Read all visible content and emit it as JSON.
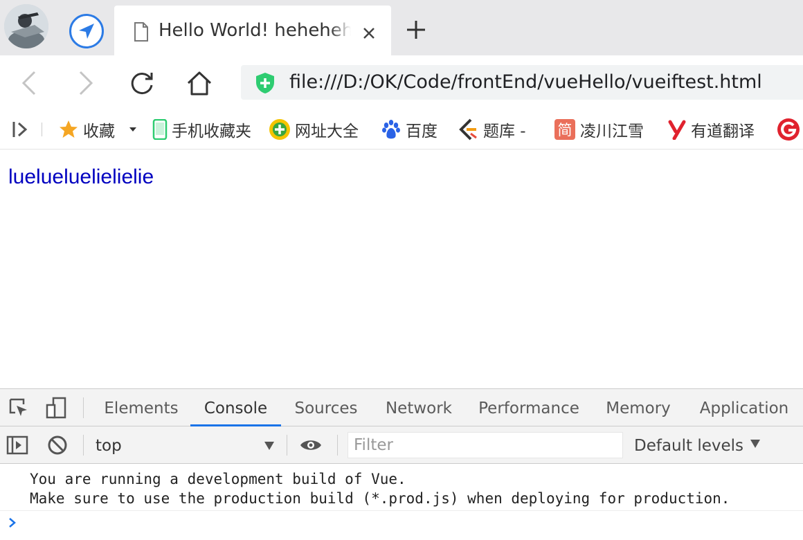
{
  "tab": {
    "title": "Hello World! hehehehehe"
  },
  "toolbar": {
    "url": "file:///D:/OK/Code/frontEnd/vueHello/vueiftest.html"
  },
  "bookmarks": [
    {
      "label": "收藏",
      "icon": "star-icon"
    },
    {
      "label": "手机收藏夹",
      "icon": "mobile-icon"
    },
    {
      "label": "网址大全",
      "icon": "site-nav-icon"
    },
    {
      "label": "百度",
      "icon": "baidu-paw-icon"
    },
    {
      "label": "题库 -",
      "icon": "tiku-icon"
    },
    {
      "label": "凌川江雪",
      "icon": "jianshu-icon"
    },
    {
      "label": "有道翻译",
      "icon": "youdao-icon"
    }
  ],
  "page": {
    "text": "luelueluelielielie"
  },
  "devtools": {
    "tabs": [
      "Elements",
      "Console",
      "Sources",
      "Network",
      "Performance",
      "Memory",
      "Application"
    ],
    "active_tab": "Console",
    "context": "top",
    "filter_placeholder": "Filter",
    "levels": "Default levels",
    "logs": [
      "You are running a development build of Vue.",
      "Make sure to use the production build (*.prod.js) when deploying for production."
    ]
  },
  "colors": {
    "accent_blue": "#1a73e8",
    "link_text": "#0000c0",
    "secure_green": "#2ecc71"
  }
}
